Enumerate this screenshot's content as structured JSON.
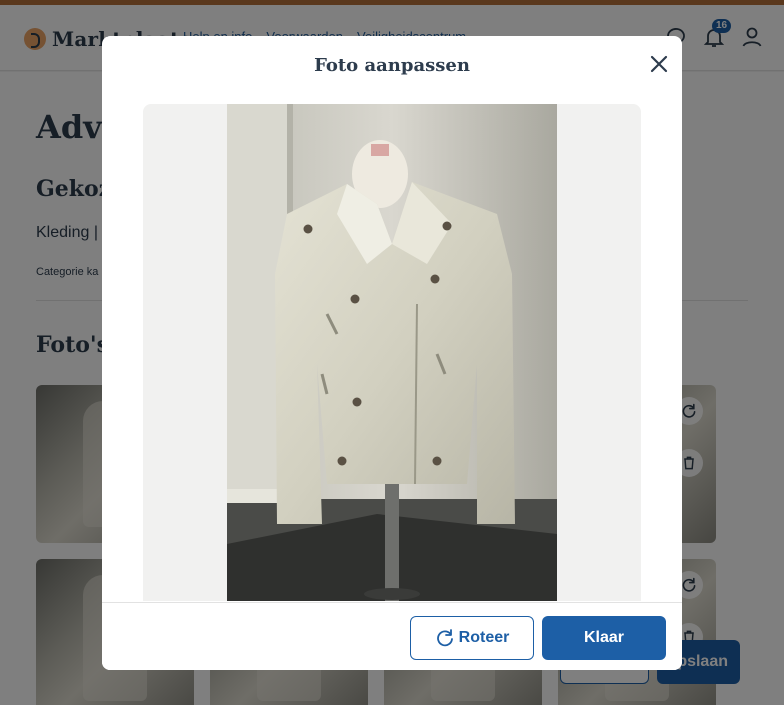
{
  "header": {
    "logo_text": "Marktplaats",
    "nav": [
      "Help en info",
      "Voorwaarden",
      "Veiligheidscentrum"
    ],
    "notifications_count": "16",
    "icons": [
      "chat-icon",
      "bell-icon",
      "user-icon"
    ]
  },
  "page": {
    "heading": "Adve",
    "chosen_heading": "Gekoze",
    "category_text": "Kleding |",
    "category_small": "Categorie ka",
    "photos_heading": "Foto's",
    "save_label": "Opslaan",
    "save_visible": "pslaan"
  },
  "modal": {
    "title": "Foto aanpassen",
    "rotate_label": "Roteer",
    "done_label": "Klaar"
  },
  "colors": {
    "primary": "#1d5fa6",
    "brand_orange": "#eda566",
    "text_dark": "#2d3c4d"
  }
}
